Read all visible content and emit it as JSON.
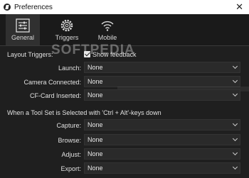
{
  "window": {
    "title": "Preferences",
    "close_glyph": "✕"
  },
  "tabs": [
    {
      "label": "General",
      "icon": "sliders-icon"
    },
    {
      "label": "Triggers",
      "icon": "gear-icon"
    },
    {
      "label": "Mobile",
      "icon": "wifi-icon"
    }
  ],
  "watermark": "SOFTPEDIA",
  "layout_triggers": {
    "heading": "Layout Triggers:",
    "show_feedback_label": "Show feedback",
    "show_feedback_checked": true,
    "rows": [
      {
        "label": "Launch:",
        "value": "None"
      },
      {
        "label": "Camera Connected:",
        "value": "None"
      },
      {
        "label": "CF-Card Inserted:",
        "value": "None"
      }
    ]
  },
  "tool_set": {
    "heading": "When a Tool Set is Selected with 'Ctrl + Alt'-keys down",
    "rows": [
      {
        "label": "Capture:",
        "value": "None"
      },
      {
        "label": "Browse:",
        "value": "None"
      },
      {
        "label": "Adjust:",
        "value": "None"
      },
      {
        "label": "Export:",
        "value": "None"
      }
    ]
  }
}
